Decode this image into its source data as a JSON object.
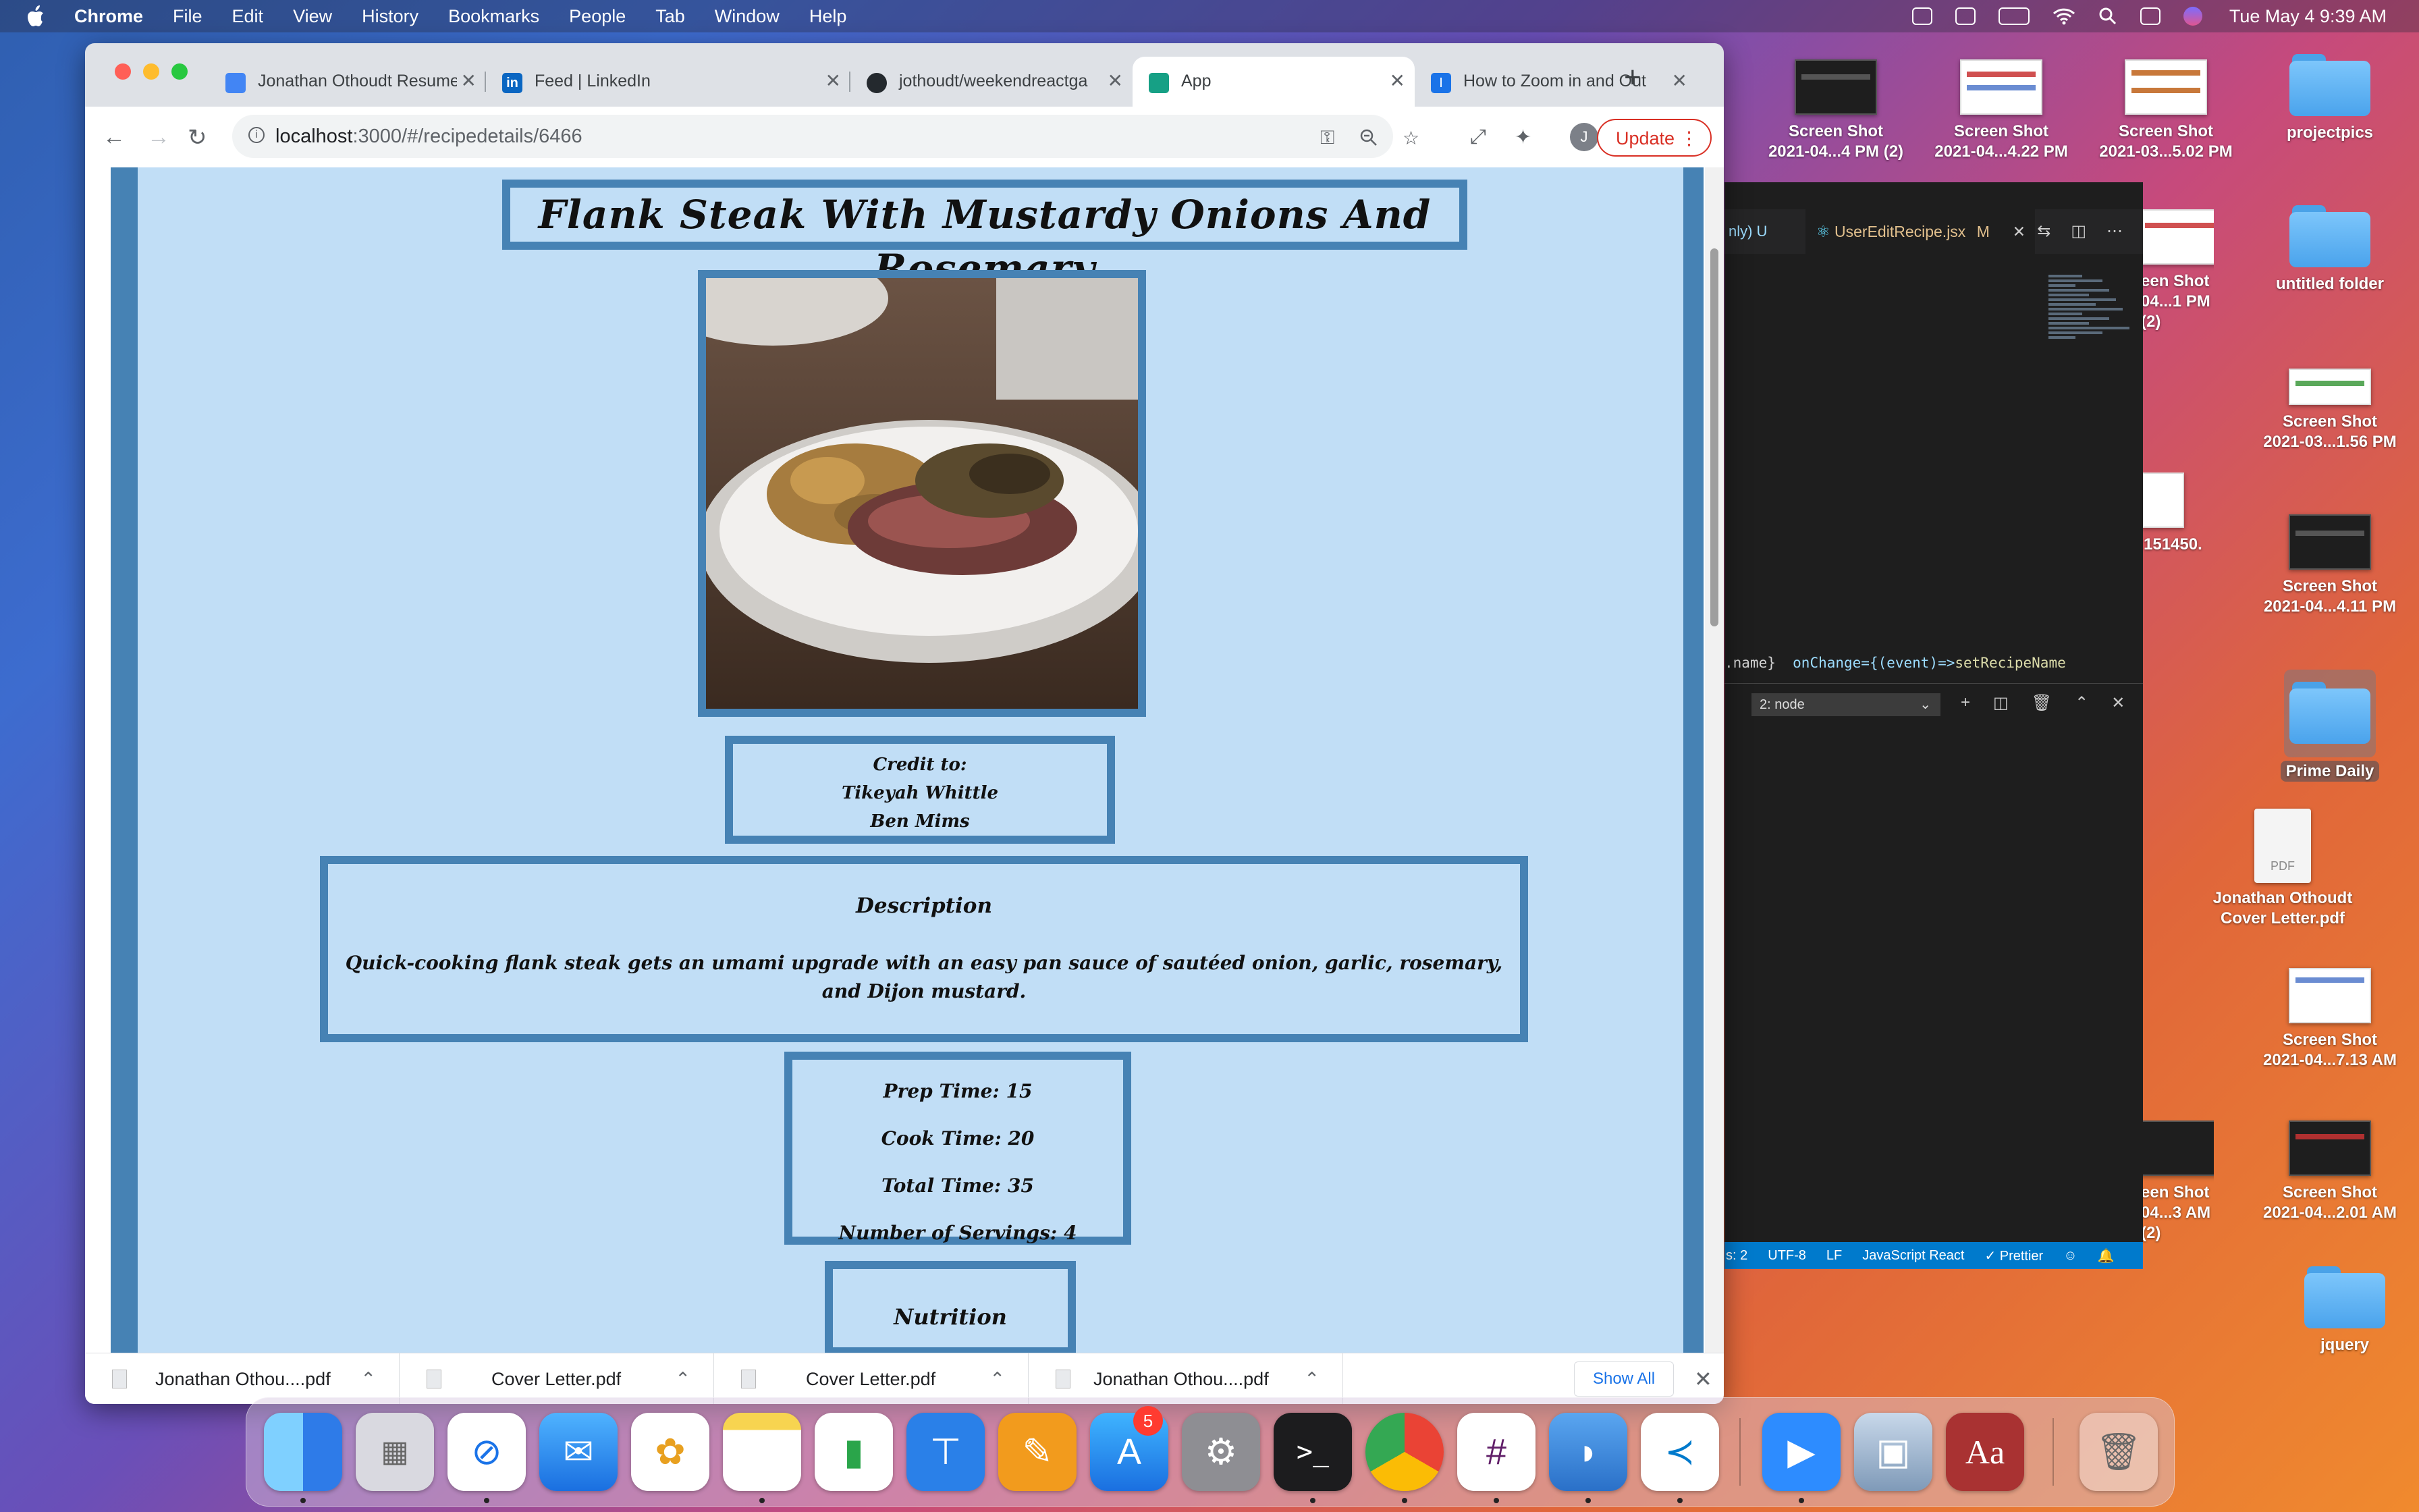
{
  "menubar": {
    "app": "Chrome",
    "items": [
      "File",
      "Edit",
      "View",
      "History",
      "Bookmarks",
      "People",
      "Tab",
      "Window",
      "Help"
    ],
    "clock": "Tue May 4  9:39 AM"
  },
  "desktop": {
    "icons": [
      {
        "label_l1": "Screen Shot",
        "label_l2": "2021-04...4 PM (2)",
        "kind": "screenshot"
      },
      {
        "label_l1": "Screen Shot",
        "label_l2": "2021-04...4.22 PM",
        "kind": "screenshot"
      },
      {
        "label_l1": "Screen Shot",
        "label_l2": "2021-03...5.02 PM",
        "kind": "screenshot"
      },
      {
        "label_l1": "projectpics",
        "label_l2": "",
        "kind": "folder"
      },
      {
        "label_l1": "een Shot",
        "label_l2": "04...1 PM (2)",
        "kind": "screenshot"
      },
      {
        "label_l1": "untitled folder",
        "label_l2": "",
        "kind": "folder"
      },
      {
        "label_l1": "Screen Shot",
        "label_l2": "2021-03...1.56 PM",
        "kind": "screenshot"
      },
      {
        "label_l1": "151450.",
        "label_l2": "",
        "kind": "screenshot"
      },
      {
        "label_l1": "Screen Shot",
        "label_l2": "2021-04...4.11 PM",
        "kind": "screenshot"
      },
      {
        "label_l1": "Prime Daily",
        "label_l2": "",
        "kind": "folder"
      },
      {
        "label_l1": "Jonathan Othoudt",
        "label_l2": "Cover Letter.pdf",
        "kind": "pdf"
      },
      {
        "label_l1": "Screen Shot",
        "label_l2": "2021-04...7.13 AM",
        "kind": "screenshot"
      },
      {
        "label_l1": "een Shot",
        "label_l2": "04...3 AM (2)",
        "kind": "screenshot"
      },
      {
        "label_l1": "Screen Shot",
        "label_l2": "2021-04...2.01 AM",
        "kind": "screenshot"
      },
      {
        "label_l1": "jquery",
        "label_l2": "",
        "kind": "folder"
      }
    ],
    "pdf_badge": "PDF"
  },
  "vscode": {
    "tab_dim": "nly) U",
    "tab_active": "UserEditRecipe.jsx",
    "tab_modified": "M",
    "code_line": {
      "a": ".name}",
      "b": "onChange={(event)=>",
      "c": "setRecipeName"
    },
    "terminal_select": "2: node",
    "status": [
      "s: 2",
      "UTF-8",
      "LF",
      "JavaScript React",
      "✓ Prettier"
    ]
  },
  "chrome": {
    "tabs": [
      {
        "title": "Jonathan Othoudt Resume",
        "favicon_color": "#4285f4"
      },
      {
        "title": "Feed | LinkedIn",
        "favicon_color": "#0a66c2"
      },
      {
        "title": "jothoudt/weekendreactga",
        "favicon_color": "#24292e"
      },
      {
        "title": "App",
        "favicon_color": "#16a085"
      },
      {
        "title": "How to Zoom in and Out",
        "favicon_color": "#1a73e8"
      }
    ],
    "url_host": "localhost",
    "url_path": ":3000/#/recipedetails/6466",
    "update_label": "Update",
    "profile_initial": "J"
  },
  "recipe": {
    "title": "Flank Steak With Mustardy Onions And Rosemary",
    "credit_label": "Credit to:",
    "credits": [
      "Tikeyah Whittle",
      "Ben Mims"
    ],
    "description_heading": "Description",
    "description": "Quick-cooking flank steak gets an umami upgrade with an easy pan sauce of sautéed onion, garlic, rosemary, and Dijon mustard.",
    "prep_time": "Prep Time: 15",
    "cook_time": "Cook Time: 20",
    "total_time": "Total Time: 35",
    "servings": "Number of Servings: 4",
    "next_section_partial": "Nutrition"
  },
  "downloads": {
    "items": [
      "Jonathan Othou....pdf",
      "Cover Letter.pdf",
      "Cover Letter.pdf",
      "Jonathan Othou....pdf"
    ],
    "show_all": "Show All"
  },
  "dock": {
    "apps": [
      "finder",
      "launchpad",
      "safari",
      "mail",
      "photos",
      "notes",
      "numbers",
      "keynote",
      "pages",
      "app-store",
      "system-preferences",
      "terminal",
      "chrome",
      "slack",
      "tableplus",
      "vscode",
      "zoom",
      "preview",
      "dictionary",
      "trash"
    ],
    "app_store_badge": "5"
  }
}
